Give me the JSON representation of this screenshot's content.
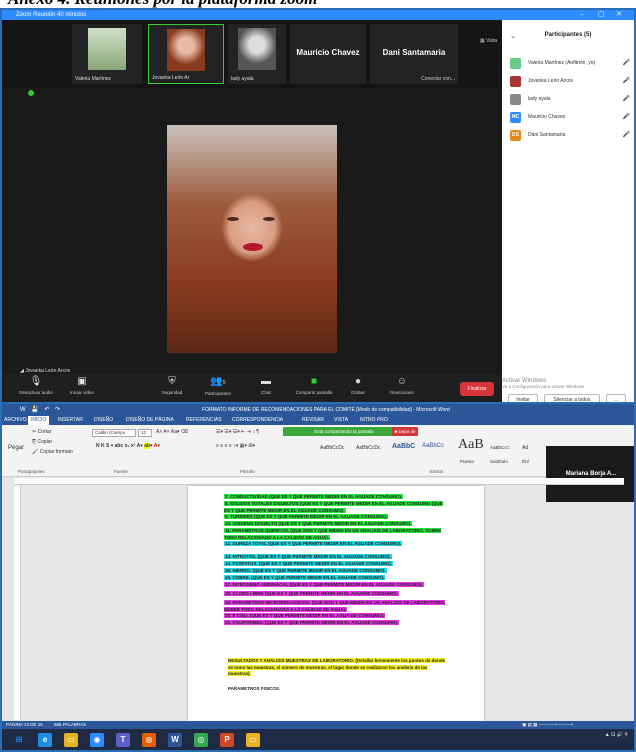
{
  "caption": "Anexo 4. Reuniones por la plataforma zoom",
  "zoom": {
    "window_title": "Zoom Reunión 40 minutos",
    "view_label": "Vista",
    "tiles": [
      {
        "name": "Valeria Martínez",
        "avatar": "face-green"
      },
      {
        "name": "Jovanka León Ar",
        "avatar": "face-red"
      },
      {
        "name": "lady ayala",
        "avatar": "face-gray"
      },
      {
        "name": "Mauricio Chavez",
        "avatar": ""
      },
      {
        "name": "Dani Santamaria",
        "sub": "Conectar con...",
        "avatar": ""
      }
    ],
    "speaker_name": "Jovanka León Arcos",
    "toolbar": [
      {
        "label": "Desactivar audio",
        "icon": "mic-icon"
      },
      {
        "label": "Iniciar video",
        "icon": "video-off-icon"
      },
      {
        "label": "Seguridad",
        "icon": "shield-icon"
      },
      {
        "label": "Participantes",
        "icon": "participants-icon",
        "count": "5"
      },
      {
        "label": "Chat",
        "icon": "chat-icon"
      },
      {
        "label": "Compartir pantalla",
        "icon": "share-screen-icon"
      },
      {
        "label": "Grabar",
        "icon": "record-icon"
      },
      {
        "label": "Reacciones",
        "icon": "reactions-icon"
      }
    ],
    "end_label": "Finalizar",
    "panel_title": "Participantes (5)",
    "participants": [
      {
        "name": "Valeria Martínez (Anfitrión, yo)",
        "initials": "",
        "color": "#6c8"
      },
      {
        "name": "Jovanka León Arcos",
        "initials": "",
        "color": "#a33"
      },
      {
        "name": "lady ayala",
        "initials": "",
        "color": "#888"
      },
      {
        "name": "Mauricio Chavez",
        "initials": "MC",
        "color": "#2d8cff"
      },
      {
        "name": "Dani Santamaria",
        "initials": "DS",
        "color": "#e88a1a"
      }
    ],
    "invite_label": "Invitar",
    "mute_all_label": "Silenciar a todos",
    "watermark_line1": "Activar Windows",
    "watermark_line2": "Ve a Configuración para activar Windows"
  },
  "word": {
    "title": "FORMATO INFORME DE RECOMENDACIONES PARA EL COMITÉ [Modo de compatibilidad] - Microsoft Word",
    "menus": [
      "ARCHIVO",
      "INICIO",
      "INSERTAR",
      "DISEÑO",
      "DISEÑO DE PÁGINA",
      "REFERENCIAS",
      "CORRESPONDENCIA",
      "REVISAR",
      "VISTA",
      "NITRO PRO"
    ],
    "clipboard": {
      "cut": "Cortar",
      "copy": "Copiar",
      "paste": "Pegar",
      "format": "Copiar formato",
      "group": "Portapapeles"
    },
    "font": {
      "name": "Calibri (Cuerpo",
      "size": "12",
      "group": "Fuente"
    },
    "paragraph_group": "Párrafo",
    "styles_group": "Estilos",
    "styles": [
      "AaBbCcDc",
      "AaBbCcDc",
      "AaBbC",
      "AaBbCc",
      "AaB",
      "AaBbCcC",
      "Ad"
    ],
    "style_names": [
      "Puesto",
      "Subtítulo",
      "Énf"
    ],
    "share_banner": "Está compartiendo la pantalla",
    "stop_share": "Dejar de",
    "video_name": "Mariana Borja A...",
    "list_items": [
      {
        "text": "7. CONDUCTIVIDAD (QUE ES Y QUE PERMITE MEDIR EN EL AGUADE CONSUMO).",
        "hl": "g"
      },
      {
        "text": "8. SOLIDOS TOTALES DISUELTOS (QUE ES Y QUE PERMITE MEDIR EN EL AGUADE CONSUMO (QUE ES Y QUE PERMITE MEDIR EN EL AGUADE CONSUMO).",
        "hl": "g"
      },
      {
        "text": "9. TURBIDEZ (QUE ES Y QUE PERMITE MEDIR EN EL AGUADE CONSUMO).",
        "hl": "g"
      },
      {
        "text": "10. OXIGENO DISUELTO (QUE ES Y QUE PERMITE MEDIR EN EL AGUADE CONSUMO).",
        "hl": "g"
      },
      {
        "text": "11. PARAMETROS QUIMICOS. (QUE SON Y QUE MIDEN EN UN ANALISIS DE LABORATORIO, SOBRE TODO RELACIONADO A LA CALIDAD DE AGUA).",
        "hl": "g"
      },
      {
        "text": "12. DUREZA TOTAL (QUE ES Y QUE PERMITE MEDIR EN EL AGUADE CONSUMO).",
        "hl": "c"
      },
      {
        "text": "13. NITRATOS. (QUE ES Y QUE PERMITE MEDIR EN EL AGUADE CONSUMO).",
        "hl": "c"
      },
      {
        "text": "14. FOSFATOS. (QUE ES Y QUE PERMITE MEDIR EN EL AGUADE CONSUMO).",
        "hl": "c"
      },
      {
        "text": "15. HIERRO. (QUE ES Y QUE PERMITE MEDIR EN EL AGUADE CONSUMO).",
        "hl": "c"
      },
      {
        "text": "16. COBRE. (QUE ES Y QUE PERMITE MEDIR EN EL AGUADE CONSUMO).",
        "hl": "c"
      },
      {
        "text": "17. NITROGENO AMONIACAL (QUE ES Y QUE PERMITE MEDIR EN EL AGUADE CONSUMO).",
        "hl": "m"
      },
      {
        "text": "18. CLORO LIBRE (QUE ES Y QUE PERMITE MEDIR EN EL AGUADE CONSUMO).",
        "hl": "m"
      },
      {
        "text": "19. PARAMETROS MICROBIOLOGICOS. (QUE SON Y QUE MIDEN EN UN ANALISIS DE LABORATORIO, SOBRE TODO RELACIONADO A LA CALIDAD DE AGUA).",
        "hl": "m"
      },
      {
        "text": "20. E COLI. (QUE ES Y QUE PERMITE MEDIR EN EL AGUA DE CONSUMO).",
        "hl": "m"
      },
      {
        "text": "21. COLIFORMES. (QUE ES Y QUE PERMITE MEDIR EN EL AGUADE CONSUMO).",
        "hl": "m"
      }
    ],
    "results_para": "RESULTADOS Y ANÁLISIS MUESTRAS DE LABORATORIO. (Detallar brevemente los puntos de donde se tomo las muestras, el número de muestras, el lugar donde se realizaron los análisis de las muestras).",
    "phys_params": "PARAMETROS FISICOS.",
    "status_page": "PÁGINA 13 DE 16",
    "status_words": "686 PALABRAS"
  },
  "taskbar": {
    "apps": [
      {
        "icon": "windows-icon",
        "color": "#2d8cff"
      },
      {
        "icon": "edge-icon",
        "color": "#1c8fe0"
      },
      {
        "icon": "file-explorer-icon",
        "color": "#e6b422"
      },
      {
        "icon": "zoom-icon",
        "color": "#2d8cff"
      },
      {
        "icon": "teams-icon",
        "color": "#5b5fc7"
      },
      {
        "icon": "firefox-icon",
        "color": "#e66000"
      },
      {
        "icon": "word-icon",
        "color": "#2b579a"
      },
      {
        "icon": "chrome-icon",
        "color": "#34a853"
      },
      {
        "icon": "powerpoint-icon",
        "color": "#d24726"
      },
      {
        "icon": "folder-icon",
        "color": "#e6b422"
      }
    ]
  }
}
